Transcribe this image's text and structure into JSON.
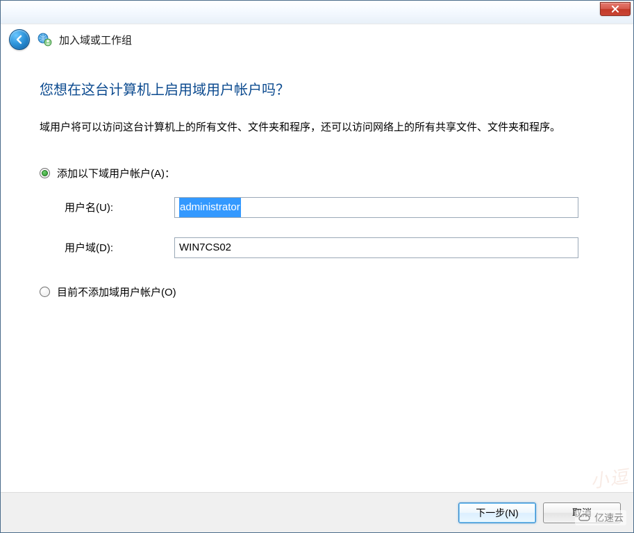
{
  "window": {
    "header_title": "加入域或工作组"
  },
  "page": {
    "heading": "您想在这台计算机上启用域用户帐户吗？",
    "description": "域用户将可以访问这台计算机上的所有文件、文件夹和程序，还可以访问网络上的所有共享文件、文件夹和程序。",
    "option_add": {
      "label": "添加以下域用户帐户(A)：",
      "selected": true,
      "fields": {
        "username": {
          "label": "用户名(U):",
          "value": "administrator"
        },
        "domain": {
          "label": "用户域(D):",
          "value": "WIN7CS02"
        }
      }
    },
    "option_skip": {
      "label": "目前不添加域用户帐户(O)",
      "selected": false
    }
  },
  "footer": {
    "next": "下一步(N)",
    "cancel": "取消"
  },
  "brand": "亿速云"
}
